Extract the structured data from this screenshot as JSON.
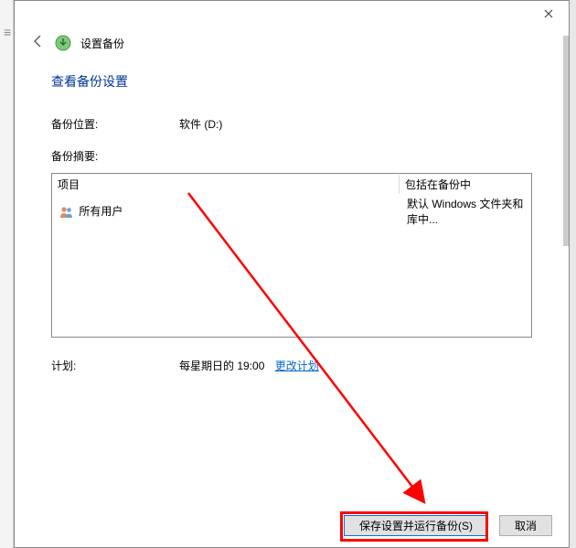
{
  "header": {
    "title": "设置备份"
  },
  "page": {
    "title": "查看备份设置"
  },
  "location": {
    "label": "备份位置:",
    "value": "软件 (D:)"
  },
  "summary": {
    "label": "备份摘要:",
    "columns": {
      "item": "项目",
      "included": "包括在备份中"
    },
    "rows": [
      {
        "item": "所有用户",
        "included": "默认 Windows 文件夹和库中..."
      }
    ]
  },
  "schedule": {
    "label": "计划:",
    "value": "每星期日的 19:00",
    "change_link": "更改计划"
  },
  "footer": {
    "save_run": "保存设置并运行备份(S)",
    "cancel": "取消"
  }
}
